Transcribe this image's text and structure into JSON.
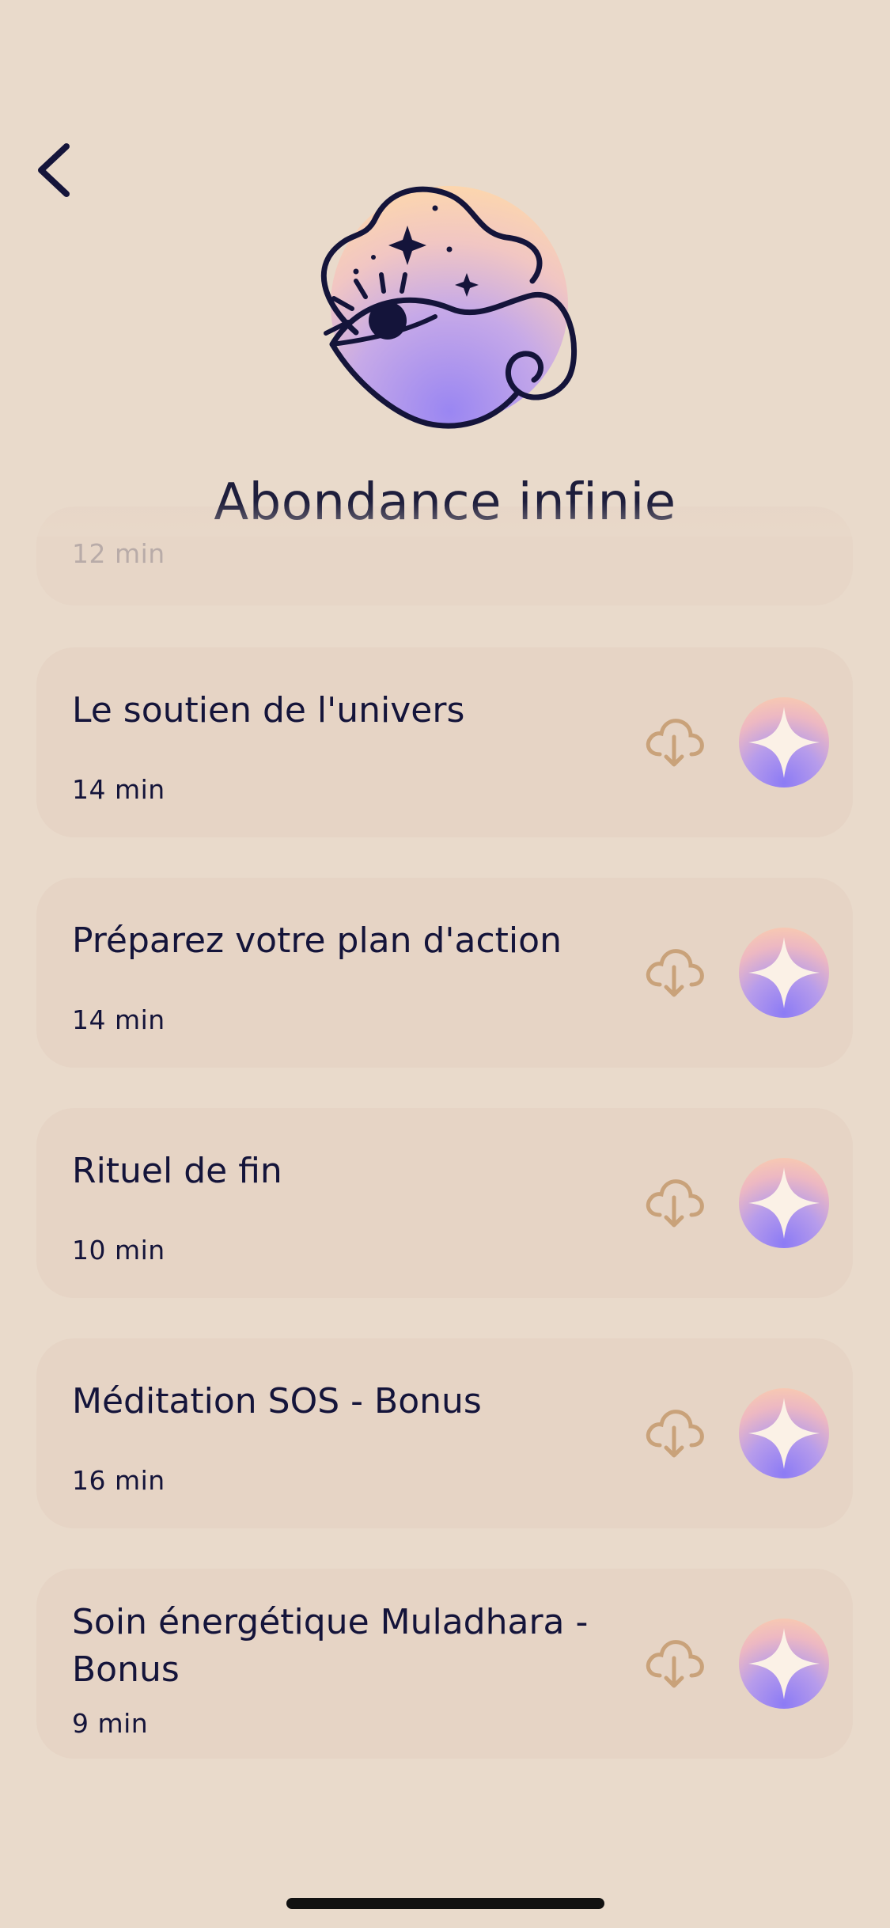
{
  "header": {
    "title": "Abondance infinie"
  },
  "partial_item": {
    "duration": "12 min"
  },
  "items": [
    {
      "title": "Le soutien de l'univers",
      "duration": "14 min"
    },
    {
      "title": "Préparez votre plan d'action",
      "duration": "14 min"
    },
    {
      "title": "Rituel de fin",
      "duration": "10 min"
    },
    {
      "title": "Méditation SOS - Bonus",
      "duration": "16 min"
    },
    {
      "title": "Soin énergétique Muladhara - Bonus",
      "duration": "9 min"
    }
  ],
  "icons": {
    "back": "chevron-left-icon",
    "download": "cloud-download-icon",
    "play": "sparkle-star-icon",
    "hero": "mystic-eye-cloud-illustration"
  },
  "colors": {
    "background": "#E9DACB",
    "card": "#E6D4C5",
    "text": "#14143A",
    "download_icon": "#C9A27A",
    "orb_top": "#FDD2A9",
    "orb_bottom": "#8C7BF5"
  }
}
